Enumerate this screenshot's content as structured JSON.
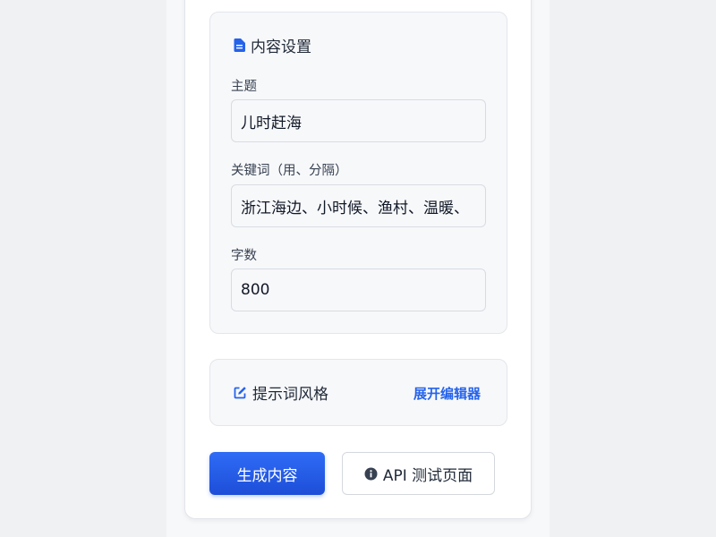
{
  "content_settings": {
    "title": "内容设置",
    "icon": "document-icon",
    "fields": {
      "topic": {
        "label": "主题",
        "value": "儿时赶海"
      },
      "keywords": {
        "label": "关键词（用、分隔）",
        "value": "浙江海边、小时候、渔村、温暖、"
      },
      "word_count": {
        "label": "字数",
        "value": "800"
      }
    }
  },
  "prompt_style": {
    "title": "提示词风格",
    "icon": "edit-icon",
    "expand_label": "展开编辑器"
  },
  "actions": {
    "generate_label": "生成内容",
    "api_test_label": "API 测试页面",
    "api_test_icon": "info-icon"
  },
  "colors": {
    "accent": "#2563eb",
    "primary_button": "#1d4ed8"
  }
}
